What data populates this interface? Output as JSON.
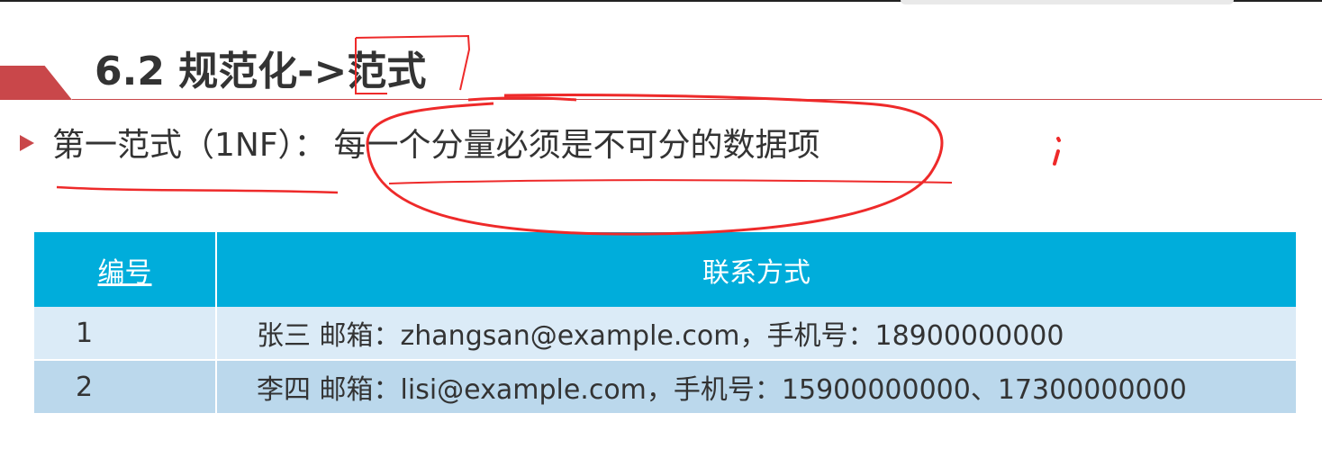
{
  "slide": {
    "title": "6.2 规范化->范式",
    "bullet": {
      "term": "第一范式（1NF）：",
      "definition": "每一个分量必须是不可分的数据项"
    }
  },
  "table": {
    "headers": [
      "编号",
      "联系方式"
    ],
    "rows": [
      {
        "id": "1",
        "contact": "张三 邮箱：zhangsan@example.com，手机号：18900000000"
      },
      {
        "id": "2",
        "contact": "李四 邮箱：lisi@example.com，手机号：15900000000、17300000000"
      }
    ]
  },
  "colors": {
    "accent_red": "#c9474a",
    "header_blue": "#00addb",
    "row_light": "#dbebf7",
    "row_dark": "#bbd8ec",
    "annotation_red": "#ee2a2a"
  }
}
